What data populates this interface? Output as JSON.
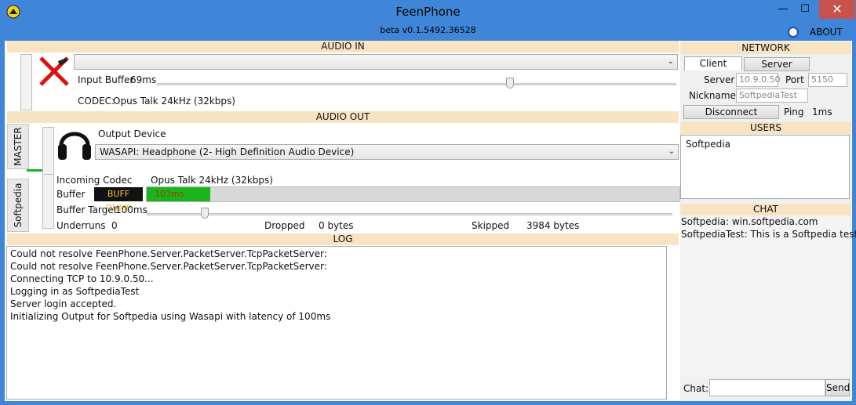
{
  "window": {
    "title": "FeenPhone",
    "subtitle": "beta v0.1.5492.36528",
    "minimize_glyph": "—",
    "maximize_glyph": "☐",
    "close_glyph": "✕",
    "about_label": "ABOUT"
  },
  "audio_in": {
    "header": "AUDIO IN",
    "device": "",
    "input_buffer_label": "Input Buffer",
    "input_buffer_value": "69ms",
    "input_buffer_level": 0.68,
    "codec_label": "CODEC:",
    "codec_value": "Opus Talk 24kHz (32kbps)"
  },
  "audio_out": {
    "header": "AUDIO OUT",
    "tabs": [
      {
        "label": "MASTER"
      },
      {
        "label": "Softpedia"
      }
    ],
    "output_device_label": "Output Device",
    "output_device_value": "WASAPI: Headphone (2- High Definition Audio Device)",
    "incoming_codec_label": "Incoming Codec",
    "incoming_codec_value": "Opus Talk 24kHz (32kbps)",
    "buffer_label": "Buffer",
    "buff_dump_label": "BUFF DUMP",
    "buffer_value": "103ms",
    "buffer_fill_fraction": 0.12,
    "buffer_target_label": "Buffer Target",
    "buffer_target_value": "100ms",
    "buffer_target_level": 0.11,
    "underruns_label": "Underruns",
    "underruns_value": "0",
    "dropped_label": "Dropped",
    "dropped_value": "0 bytes",
    "skipped_label": "Skipped",
    "skipped_value": "3984 bytes"
  },
  "log": {
    "header": "LOG",
    "lines": [
      "Could not resolve FeenPhone.Server.PacketServer.TcpPacketServer:",
      "Could not resolve FeenPhone.Server.PacketServer.TcpPacketServer:",
      "Connecting TCP to 10.9.0.50...",
      "Logging in as SoftpediaTest",
      "Server login accepted.",
      "Initializing Output for Softpedia using Wasapi with latency of 100ms"
    ]
  },
  "network": {
    "header": "NETWORK",
    "client_tab": "Client",
    "server_tab": "Server",
    "server_label": "Server",
    "server_value": "10.9.0.50",
    "port_label": "Port",
    "port_value": "5150",
    "nickname_label": "Nickname",
    "nickname_value": "SoftpediaTest",
    "disconnect_label": "Disconnect",
    "ping_label": "Ping",
    "ping_value": "1ms"
  },
  "users": {
    "header": "USERS",
    "list": [
      "Softpedia"
    ]
  },
  "chat": {
    "header": "CHAT",
    "messages": [
      "Softpedia: win.softpedia.com",
      "SoftpediaTest: This is a Softpedia test,"
    ],
    "input_label": "Chat:",
    "input_value": "",
    "send_label": "Send"
  },
  "colors": {
    "titlebar": "#3f86d8",
    "section_header": "#f8e3c3",
    "buffer_fill": "#18b51c",
    "close_button": "#c7534c"
  }
}
